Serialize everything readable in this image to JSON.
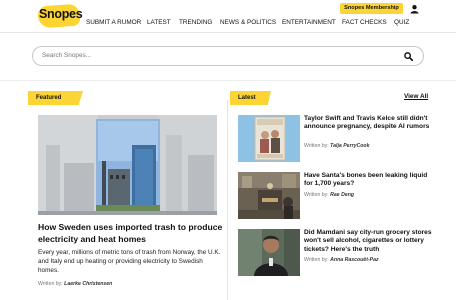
{
  "header": {
    "logo_text": "Snopes",
    "membership_label": "Snopes Membership",
    "nav": [
      "SUBMIT A RUMOR",
      "LATEST",
      "TRENDING",
      "NEWS & POLITICS",
      "ENTERTAINMENT",
      "FACT CHECKS",
      "QUIZ"
    ]
  },
  "search": {
    "placeholder": "Search Snopes..."
  },
  "featured": {
    "section_label": "Featured",
    "title": "How Sweden uses imported trash to produce electricity and heat homes",
    "description": "Every year, millions of metric tons of trash from Norway, the U.K. and Italy end up heating or providing electricity to Swedish homes.",
    "byline_prefix": "Written by:",
    "author": "Laerke Christensen"
  },
  "latest": {
    "section_label": "Latest",
    "view_all": "View All",
    "items": [
      {
        "title": "Taylor Swift and Travis Kelce still didn't announce pregnancy, despite AI rumors",
        "byline_prefix": "Written by:",
        "author": "Talja PerryCook"
      },
      {
        "title": "Have Santa's bones been leaking liquid for 1,700 years?",
        "byline_prefix": "Written by:",
        "author": "Rae Deng"
      },
      {
        "title": "Did Mamdani say city-run grocery stores won't sell alcohol, cigarettes or lottery tickets? Here's the truth",
        "byline_prefix": "Written by:",
        "author": "Anna Rascouët-Paz"
      }
    ]
  },
  "colors": {
    "brand_yellow": "#fcd535",
    "text": "#111111",
    "muted": "#777777"
  }
}
